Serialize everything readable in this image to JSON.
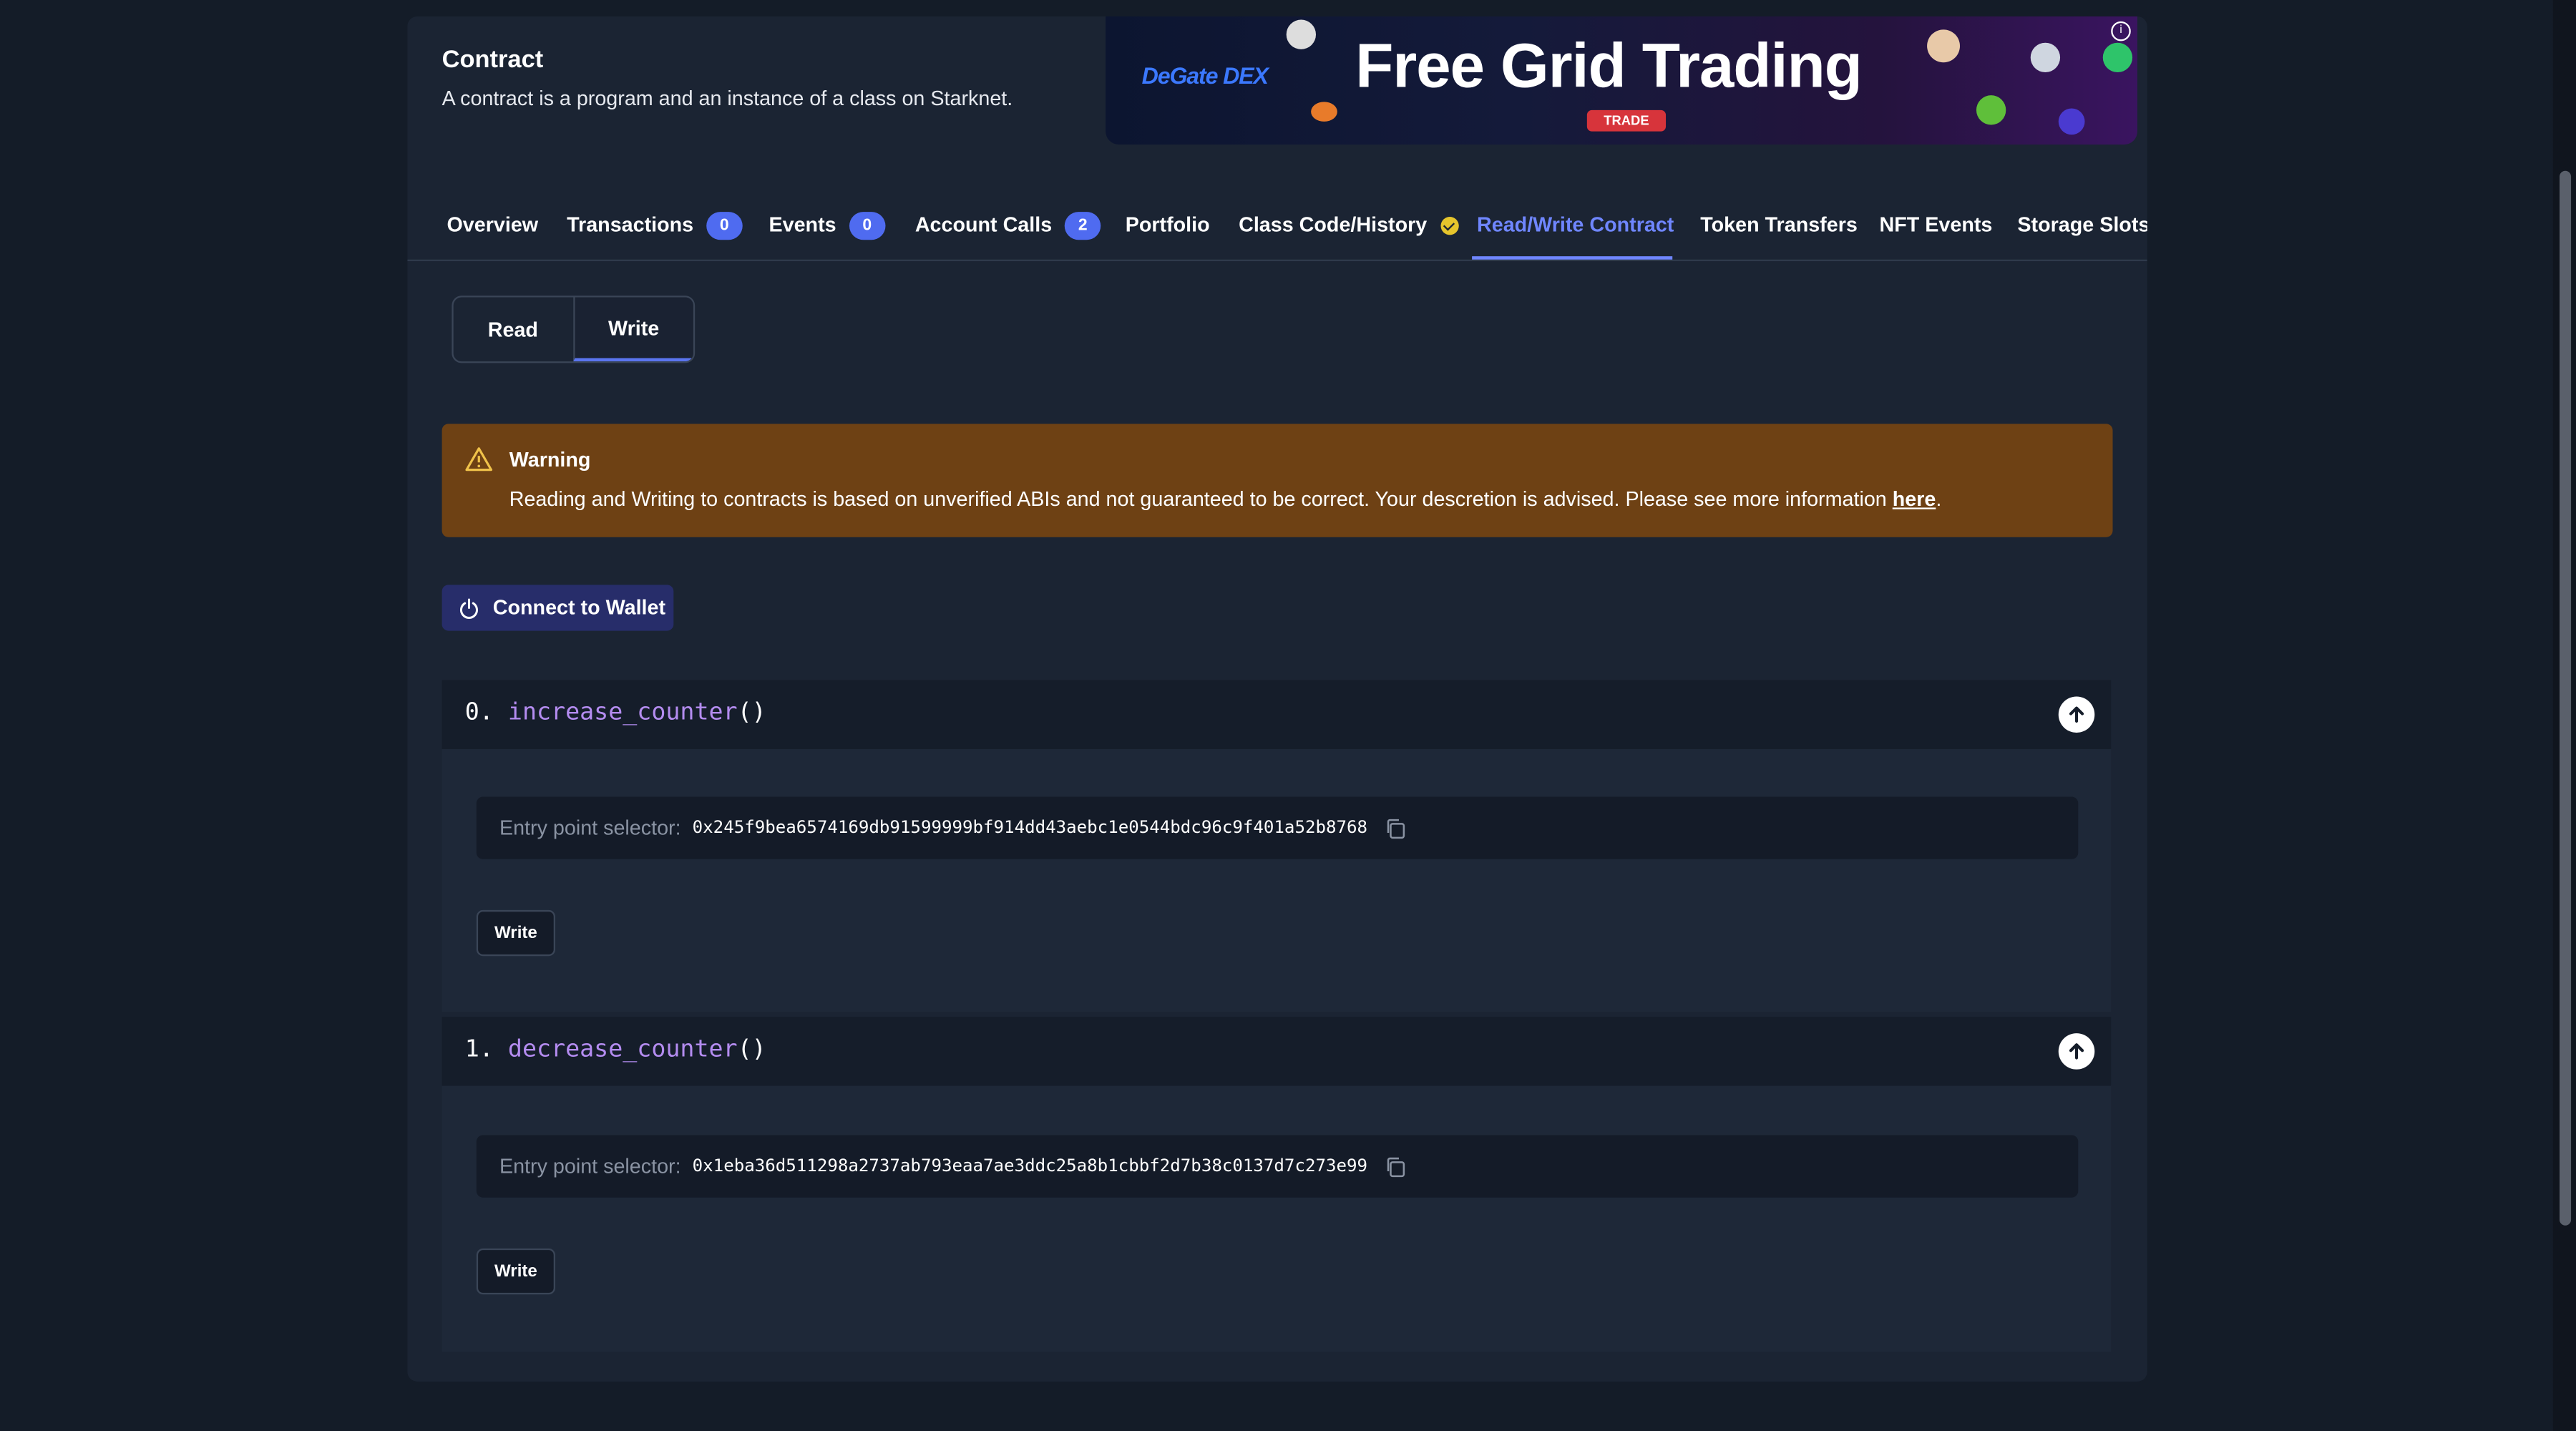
{
  "header": {
    "title": "Contract",
    "subtitle": "A contract is a program and an instance of a class on Starknet."
  },
  "ad": {
    "logo": "DeGate DEX",
    "headline": "Free Grid Trading",
    "cta": "TRADE",
    "info_icon": "info-icon"
  },
  "tabs": [
    {
      "label": "Overview"
    },
    {
      "label": "Transactions",
      "badge": "0"
    },
    {
      "label": "Events",
      "badge": "0"
    },
    {
      "label": "Account Calls",
      "badge": "2"
    },
    {
      "label": "Portfolio"
    },
    {
      "label": "Class Code/History",
      "icon": "verified-check-icon"
    },
    {
      "label": "Read/Write Contract",
      "active": true
    },
    {
      "label": "Token Transfers"
    },
    {
      "label": "NFT Events"
    },
    {
      "label": "Storage Slots"
    }
  ],
  "mode_toggle": {
    "read": "Read",
    "write": "Write",
    "active": "Write"
  },
  "warning": {
    "title": "Warning",
    "text": "Reading and Writing to contracts is based on unverified ABIs and not guaranteed to be correct. Your descretion is advised. Please see more information ",
    "link": "here",
    "trailing": "."
  },
  "connect_wallet": {
    "label": "Connect to Wallet"
  },
  "functions": [
    {
      "index": "0.",
      "name": "increase_counter",
      "parens": "()",
      "selector_label": "Entry point selector:",
      "selector": "0x245f9bea6574169db91599999bf914dd43aebc1e0544bdc96c9f401a52b8768",
      "write_label": "Write"
    },
    {
      "index": "1.",
      "name": "decrease_counter",
      "parens": "()",
      "selector_label": "Entry point selector:",
      "selector": "0x1eba36d511298a2737ab793eaa7ae3ddc25a8b1cbbf2d7b38c0137d7c273e99",
      "write_label": "Write"
    }
  ],
  "colors": {
    "page_bg": "#141c28",
    "card_bg": "#1b2433",
    "accent": "#6f86ff",
    "badge": "#4f6bf0",
    "warning_bg": "#6e4114",
    "function_name": "#b48cf0"
  }
}
